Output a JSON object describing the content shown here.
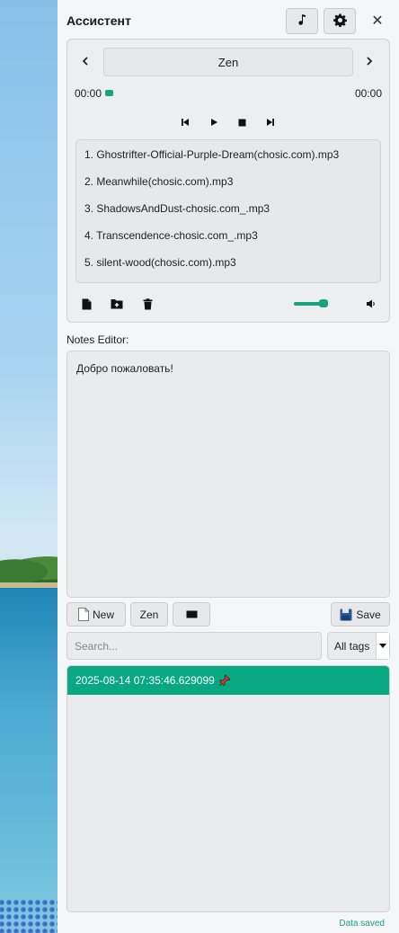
{
  "header": {
    "title": "Ассистент",
    "music_icon": "music-note-icon",
    "settings_icon": "gear-icon",
    "close_label": "✕"
  },
  "player": {
    "station": "Zen",
    "time_current": "00:00",
    "time_total": "00:00",
    "seek_progress": 0,
    "volume_level": 0.85,
    "playlist": [
      "1. Ghostrifter-Official-Purple-Dream(chosic.com).mp3",
      "2. Meanwhile(chosic.com).mp3",
      "3. ShadowsAndDust-chosic.com_.mp3",
      "4. Transcendence-chosic.com_.mp3",
      "5. silent-wood(chosic.com).mp3"
    ]
  },
  "notes": {
    "label": "Notes Editor:",
    "content": "Добро пожаловать!"
  },
  "toolbar": {
    "new_label": "New",
    "zen_label": "Zen",
    "save_label": "Save"
  },
  "search": {
    "placeholder": "Search...",
    "value": ""
  },
  "tags": {
    "selected": "All tags"
  },
  "notes_list": [
    {
      "timestamp": "2025-08-14 07:35:46.629099",
      "pinned": true
    }
  ],
  "status": "Data saved",
  "colors": {
    "accent": "#08a883",
    "panel_bg": "#f5f6f8"
  }
}
